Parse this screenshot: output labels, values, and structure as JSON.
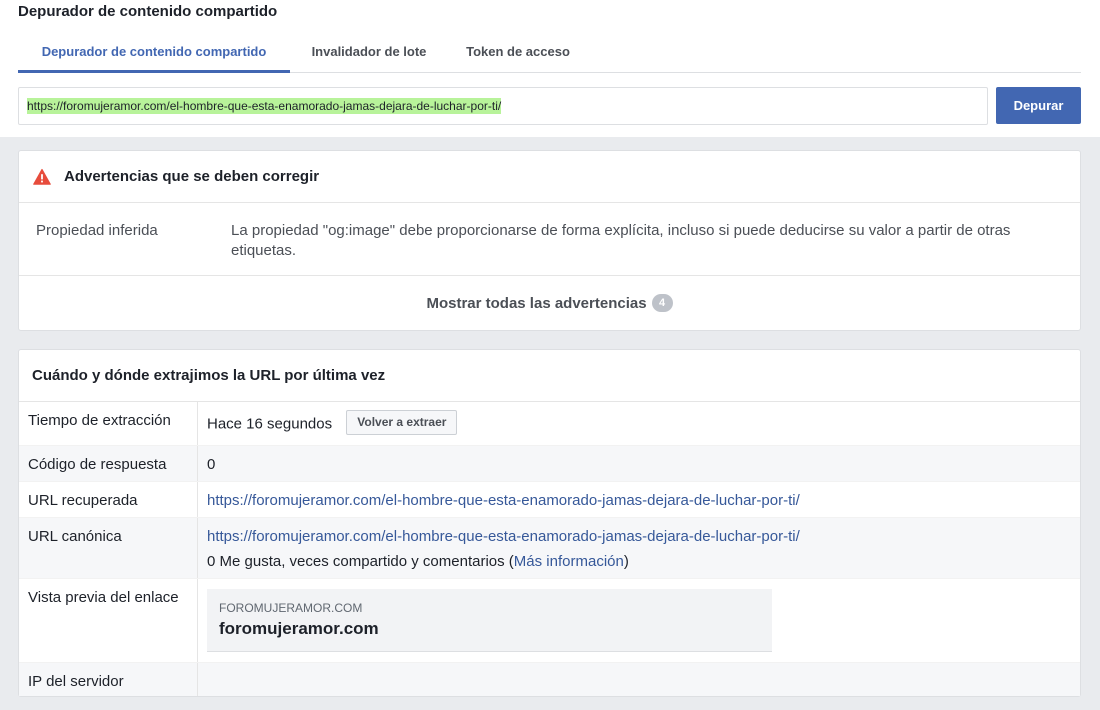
{
  "page_title": "Depurador de contenido compartido",
  "tabs": [
    {
      "label": "Depurador de contenido compartido",
      "active": true
    },
    {
      "label": "Invalidador de lote",
      "active": false
    },
    {
      "label": "Token de acceso",
      "active": false
    }
  ],
  "url_input": {
    "value": "https://foromujeramor.com/el-hombre-que-esta-enamorado-jamas-dejara-de-luchar-por-ti/"
  },
  "debug_button": "Depurar",
  "warnings": {
    "title": "Advertencias que se deben corregir",
    "icon": "warning-triangle-icon",
    "items": [
      {
        "property": "Propiedad inferida",
        "message": "La propiedad \"og:image\" debe proporcionarse de forma explícita, incluso si puede deducirse su valor a partir de otras etiquetas."
      }
    ],
    "show_all_label": "Mostrar todas las advertencias",
    "count": "4"
  },
  "scrape": {
    "title": "Cuándo y dónde extrajimos la URL por última vez",
    "rows": {
      "time": {
        "label": "Tiempo de extracción",
        "value": "Hace 16 segundos",
        "button": "Volver a extraer"
      },
      "response": {
        "label": "Código de respuesta",
        "value": "0"
      },
      "fetched": {
        "label": "URL recuperada",
        "value": "https://foromujeramor.com/el-hombre-que-esta-enamorado-jamas-dejara-de-luchar-por-ti/"
      },
      "canonical": {
        "label": "URL canónica",
        "value": "https://foromujeramor.com/el-hombre-que-esta-enamorado-jamas-dejara-de-luchar-por-ti/",
        "stats_prefix": "0 Me gusta, veces compartido y comentarios (",
        "more_info": "Más información",
        "stats_suffix": ")"
      },
      "preview": {
        "label": "Vista previa del enlace",
        "domain": "FOROMUJERAMOR.COM",
        "title": "foromujeramor.com"
      },
      "ip": {
        "label": "IP del servidor",
        "value": ""
      }
    }
  },
  "colors": {
    "accent": "#4267b2",
    "link": "#365899",
    "warning": "#e74c3c",
    "url_highlight": "#b8f39a"
  }
}
